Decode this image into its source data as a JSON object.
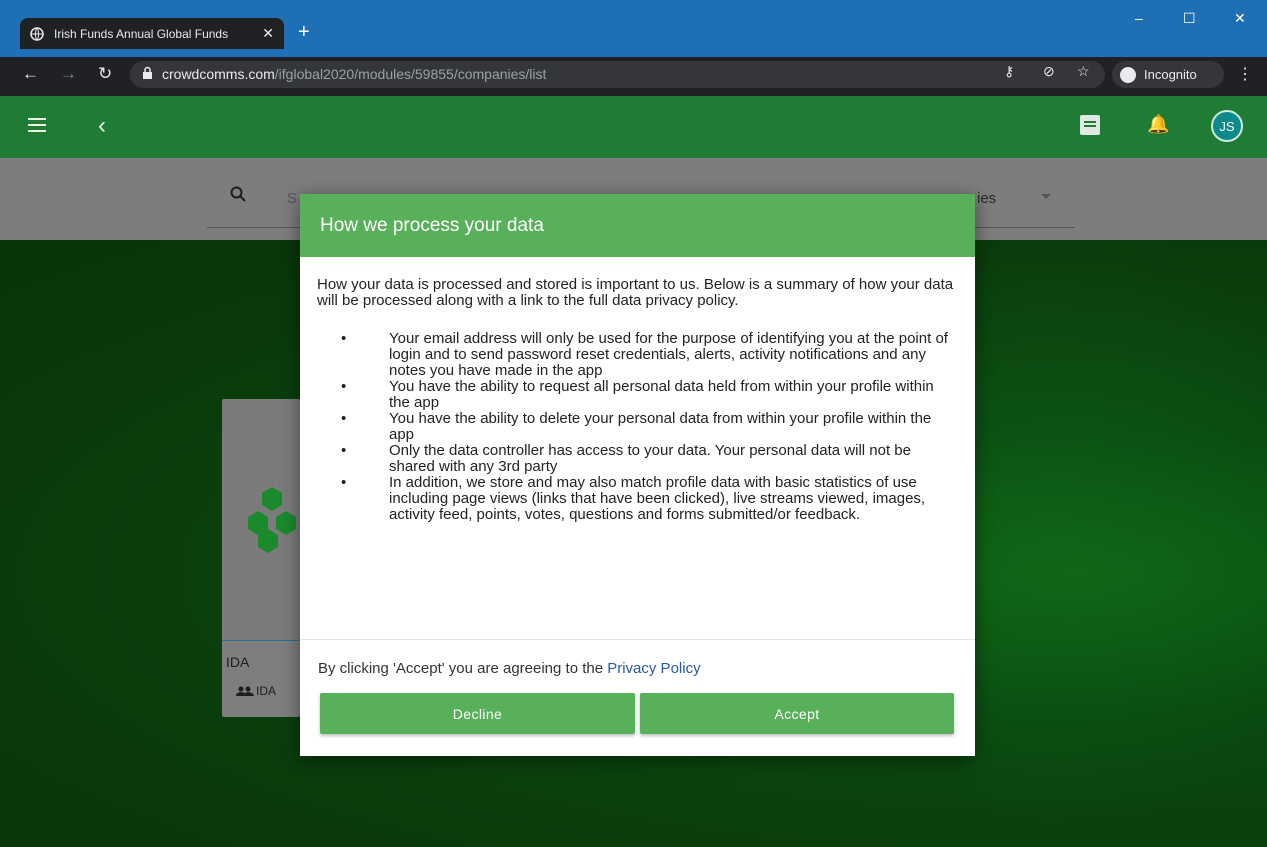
{
  "browser": {
    "tab_title": "Irish Funds Annual Global Funds",
    "url_host": "crowdcomms.com",
    "url_path": "/ifglobal2020/modules/59855/companies/list",
    "incognito_label": "Incognito",
    "accent_color": "#1f6fb5"
  },
  "app": {
    "avatar_initials": "JS",
    "header_color": "#1e7c34"
  },
  "search": {
    "placeholder": "S",
    "filter_label": "ies"
  },
  "card": {
    "name": "IDA",
    "tag": "IDA"
  },
  "modal": {
    "title": "How we process your data",
    "intro": "How your data is processed and stored is important to us. Below is a summary of how your data will be processed along with a link to the full data privacy policy.",
    "points": [
      "Your email address will only be used for the purpose of identifying you at the point of login and to send password reset credentials, alerts, activity notifications and any notes you have made in the app",
      "You have the ability to request all personal data held from within your profile within the app",
      "You have the ability to delete your personal data from within your profile within the app",
      "Only the data controller has access to your data. Your personal data will not be shared with any 3rd party",
      "In addition, we store and may also match profile data with basic statistics of use including page views (links that have been clicked), live streams viewed, images, activity feed, points, votes, questions and forms submitted/or feedback."
    ],
    "consent_text": "By clicking 'Accept' you are agreeing to the ",
    "consent_link": "Privacy Policy",
    "decline_label": "Decline",
    "accept_label": "Accept",
    "accent_color": "#58b05a"
  }
}
